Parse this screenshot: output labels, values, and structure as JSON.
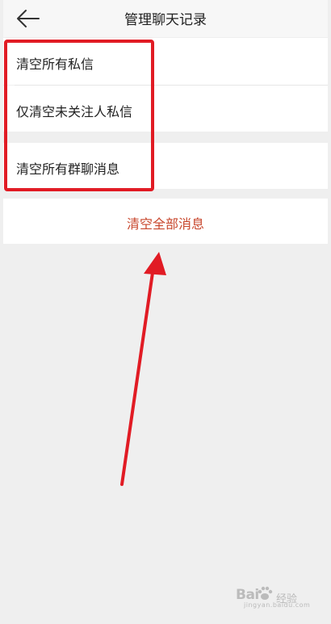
{
  "header": {
    "title": "管理聊天记录",
    "back_icon": "back-arrow-icon"
  },
  "options": [
    {
      "label": "清空所有私信"
    },
    {
      "label": "仅清空未关注人私信"
    },
    {
      "label": "清空所有群聊消息"
    }
  ],
  "clear_all": {
    "label": "清空全部消息",
    "color": "#c8472d"
  },
  "annotation": {
    "highlight_color": "#e11b24"
  },
  "watermark": {
    "brand": "Bai",
    "brand_suffix": "经验",
    "url": "jingyan.baidu.com"
  }
}
